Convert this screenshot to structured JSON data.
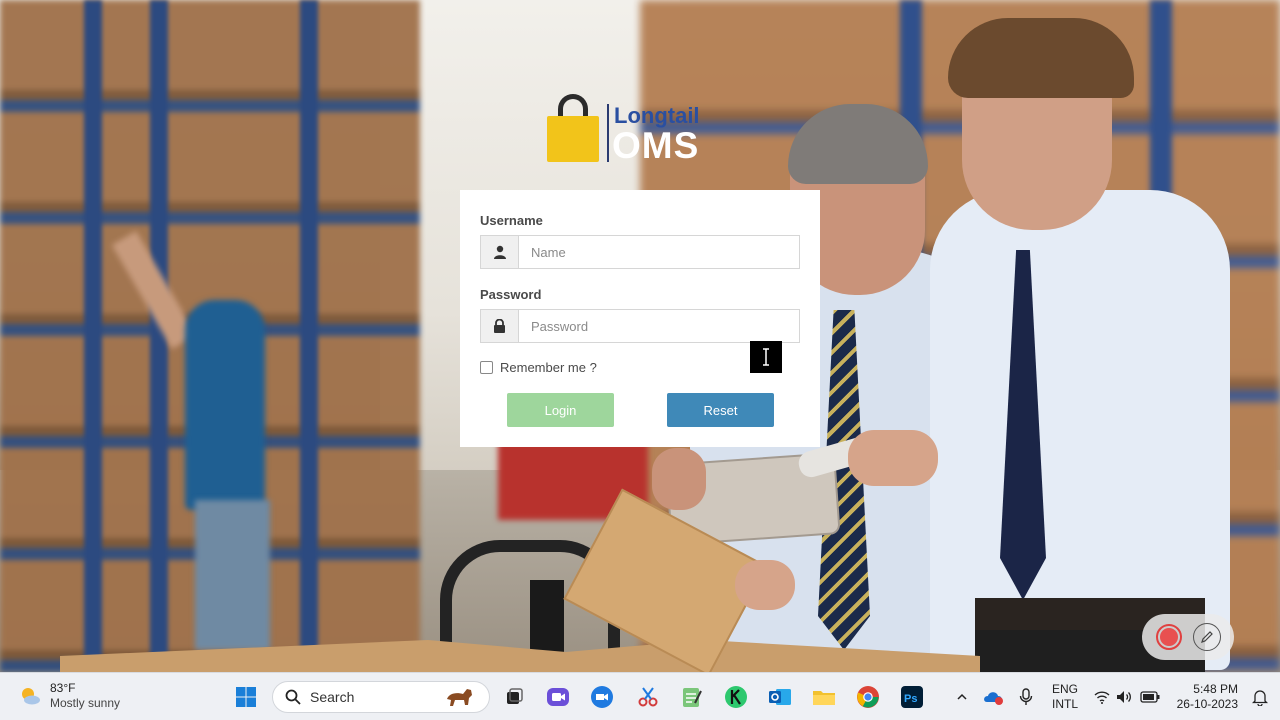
{
  "logo": {
    "name_top": "Longtail",
    "name_bottom": "OMS"
  },
  "login_form": {
    "username_label": "Username",
    "username_placeholder": "Name",
    "username_value": "",
    "password_label": "Password",
    "password_placeholder": "Password",
    "password_value": "",
    "remember_label": "Remember me ?",
    "remember_checked": false,
    "login_label": "Login",
    "reset_label": "Reset",
    "colors": {
      "login": "#9ed69c",
      "reset": "#3f89b8"
    }
  },
  "taskbar": {
    "weather": {
      "temp": "83°F",
      "desc": "Mostly sunny",
      "icon": "partly-sunny-icon"
    },
    "search_placeholder": "Search",
    "apps": [
      "windows-start-icon",
      "task-view-icon",
      "video-call-icon",
      "zoom-icon",
      "snipping-tool-icon",
      "notepad-icon",
      "kaspersky-icon",
      "outlook-icon",
      "file-explorer-icon",
      "chrome-icon",
      "photoshop-icon"
    ],
    "tray": {
      "lang_line1": "ENG",
      "lang_line2": "INTL",
      "time": "5:48 PM",
      "date": "26-10-2023"
    }
  }
}
